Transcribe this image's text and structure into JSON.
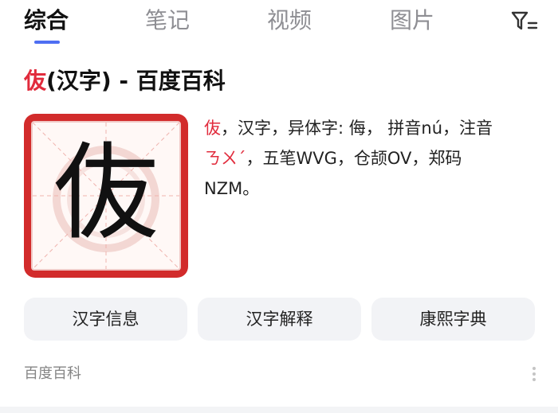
{
  "tabs": [
    {
      "label": "综合",
      "active": true
    },
    {
      "label": "笔记",
      "active": false
    },
    {
      "label": "视频",
      "active": false
    },
    {
      "label": "图片",
      "active": false
    }
  ],
  "filter_icon": "filter-icon",
  "result": {
    "title_char": "伖",
    "title_rest": "(汉字) - 百度百科",
    "thumbnail_char": "伖",
    "description": {
      "char": "伖",
      "line1_rest": "，汉字，异体字: 侮， 拼音nú，注音",
      "bopomofo": "ㄋㄨˊ",
      "line2_rest": "，五笔WVG，仓颉OV，郑码",
      "line3": "NZM。"
    },
    "actions": [
      "汉字信息",
      "汉字解释",
      "康熙字典"
    ],
    "source": "百度百科"
  },
  "colors": {
    "accent": "#4e6ef2",
    "highlight": "#e12b3c",
    "thumb_frame": "#d22b2b"
  }
}
